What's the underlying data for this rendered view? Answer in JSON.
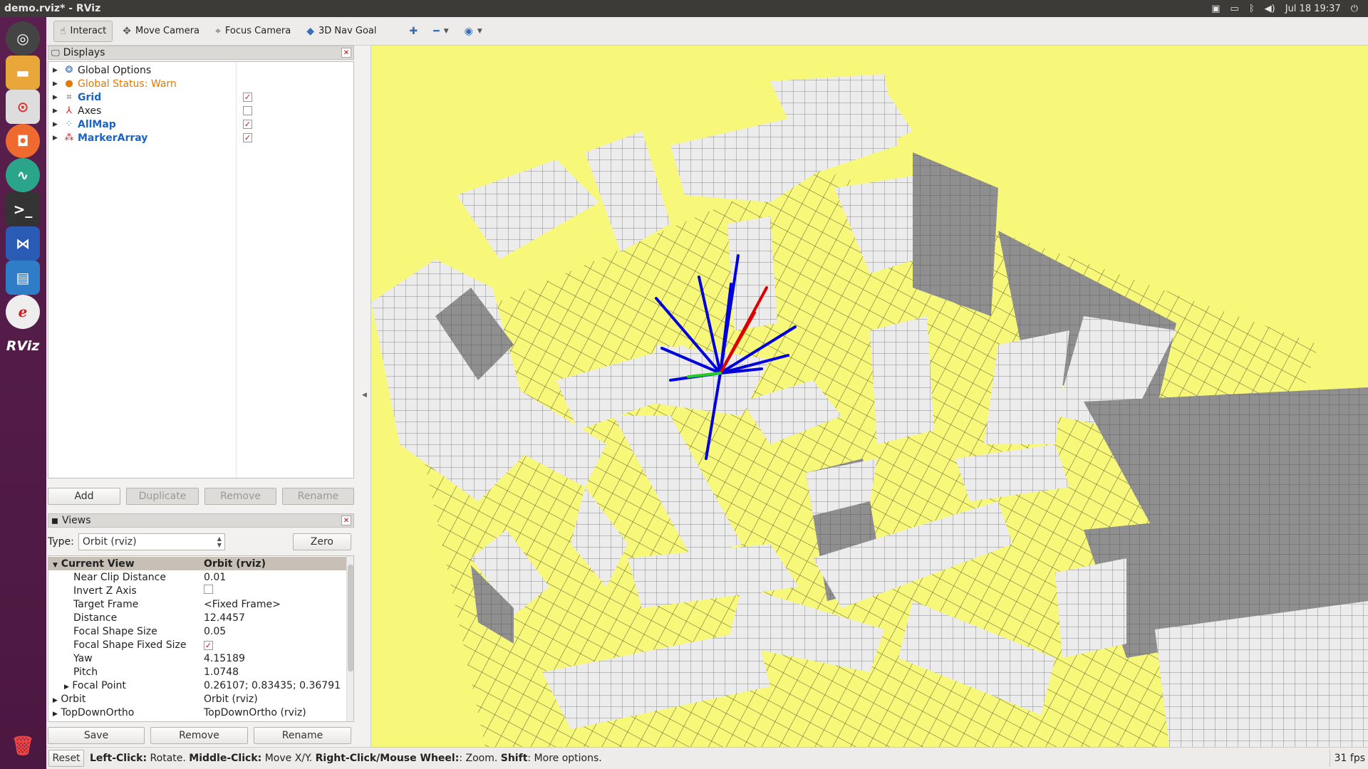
{
  "window": {
    "title": "demo.rviz* - RViz"
  },
  "tray": {
    "clock": "Jul 18 19:37"
  },
  "launcher": {
    "rviz_label": "RViz"
  },
  "toolbar": {
    "interact": "Interact",
    "move_camera": "Move Camera",
    "focus_camera": "Focus Camera",
    "nav_goal": "3D Nav Goal"
  },
  "displays": {
    "title": "Displays",
    "items": [
      {
        "label": "Global Options",
        "color": "#222222",
        "checkbox": null
      },
      {
        "label": "Global Status: Warn",
        "color": "#e07a00",
        "checkbox": null
      },
      {
        "label": "Grid",
        "color": "#1b63c6",
        "checkbox": true
      },
      {
        "label": "Axes",
        "color": "#222222",
        "checkbox": false
      },
      {
        "label": "AllMap",
        "color": "#1b63c6",
        "checkbox": true
      },
      {
        "label": "MarkerArray",
        "color": "#1b63c6",
        "checkbox": true
      }
    ],
    "buttons": {
      "add": "Add",
      "duplicate": "Duplicate",
      "remove": "Remove",
      "rename": "Rename"
    }
  },
  "views": {
    "title": "Views",
    "type_label": "Type:",
    "type_value": "Orbit (rviz)",
    "zero": "Zero",
    "current_view": {
      "label": "Current View",
      "value": "Orbit (rviz)"
    },
    "properties": [
      {
        "key": "Near Clip Distance",
        "value": "0.01"
      },
      {
        "key": "Invert Z Axis",
        "value": "",
        "checkbox": false
      },
      {
        "key": "Target Frame",
        "value": "<Fixed Frame>"
      },
      {
        "key": "Distance",
        "value": "12.4457"
      },
      {
        "key": "Focal Shape Size",
        "value": "0.05"
      },
      {
        "key": "Focal Shape Fixed Size",
        "value": "",
        "checkbox": true
      },
      {
        "key": "Yaw",
        "value": "4.15189"
      },
      {
        "key": "Pitch",
        "value": "1.0748"
      },
      {
        "key": "Focal Point",
        "value": "0.26107; 0.83435; 0.36791"
      }
    ],
    "saved": [
      {
        "key": "Orbit",
        "value": "Orbit (rviz)"
      },
      {
        "key": "TopDownOrtho",
        "value": "TopDownOrtho (rviz)"
      }
    ],
    "buttons": {
      "save": "Save",
      "remove": "Remove",
      "rename": "Rename"
    }
  },
  "status": {
    "reset": "Reset",
    "left_click": "Left-Click:",
    "left_click_desc": " Rotate. ",
    "middle_click": "Middle-Click:",
    "middle_click_desc": " Move X/Y. ",
    "right_click": "Right-Click/Mouse Wheel:",
    "right_click_desc": ": Zoom. ",
    "shift": "Shift",
    "shift_desc": ": More options.",
    "fps": "31 fps"
  },
  "colors": {
    "viewport_bg": "#f7f77a",
    "blocks": "#e8e8e8",
    "rays_blue": "#0000dd",
    "rays_red": "#dd0000",
    "ray_green": "#22cc22"
  }
}
